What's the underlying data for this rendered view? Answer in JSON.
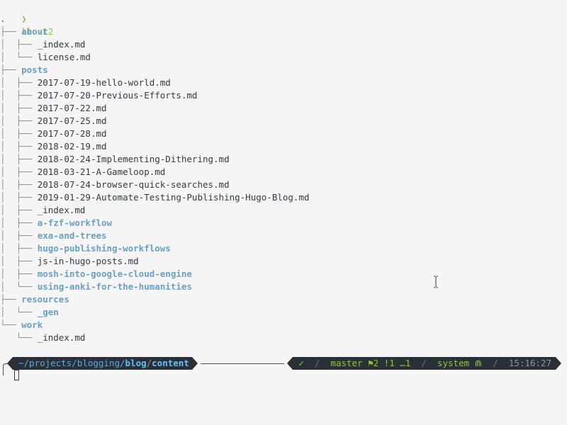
{
  "prompt": {
    "arrow": "❯",
    "command": "ll -L2"
  },
  "tree": {
    "root": ".",
    "rows": [
      {
        "prefix": "├── ",
        "name": "about",
        "kind": "dir"
      },
      {
        "prefix": "│  ├── ",
        "name": "_index.md",
        "kind": "file"
      },
      {
        "prefix": "│  └── ",
        "name": "license.md",
        "kind": "file"
      },
      {
        "prefix": "├── ",
        "name": "posts",
        "kind": "dir"
      },
      {
        "prefix": "│  ├── ",
        "name": "2017-07-19-hello-world.md",
        "kind": "file"
      },
      {
        "prefix": "│  ├── ",
        "name": "2017-07-20-Previous-Efforts.md",
        "kind": "file"
      },
      {
        "prefix": "│  ├── ",
        "name": "2017-07-22.md",
        "kind": "file"
      },
      {
        "prefix": "│  ├── ",
        "name": "2017-07-25.md",
        "kind": "file"
      },
      {
        "prefix": "│  ├── ",
        "name": "2017-07-28.md",
        "kind": "file"
      },
      {
        "prefix": "│  ├── ",
        "name": "2018-02-19.md",
        "kind": "file"
      },
      {
        "prefix": "│  ├── ",
        "name": "2018-02-24-Implementing-Dithering.md",
        "kind": "file"
      },
      {
        "prefix": "│  ├── ",
        "name": "2018-03-21-A-Gameloop.md",
        "kind": "file"
      },
      {
        "prefix": "│  ├── ",
        "name": "2018-07-24-browser-quick-searches.md",
        "kind": "file"
      },
      {
        "prefix": "│  ├── ",
        "name": "2019-01-29-Automate-Testing-Publishing-Hugo-Blog.md",
        "kind": "file"
      },
      {
        "prefix": "│  ├── ",
        "name": "_index.md",
        "kind": "file"
      },
      {
        "prefix": "│  ├── ",
        "name": "a-fzf-workflow",
        "kind": "dir"
      },
      {
        "prefix": "│  ├── ",
        "name": "exa-and-trees",
        "kind": "dir"
      },
      {
        "prefix": "│  ├── ",
        "name": "hugo-publishing-workflows",
        "kind": "dir"
      },
      {
        "prefix": "│  ├── ",
        "name": "js-in-hugo-posts.md",
        "kind": "file"
      },
      {
        "prefix": "│  ├── ",
        "name": "mosh-into-google-cloud-engine",
        "kind": "dir"
      },
      {
        "prefix": "│  └── ",
        "name": "using-anki-for-the-humanities",
        "kind": "dir"
      },
      {
        "prefix": "├── ",
        "name": "resources",
        "kind": "dir"
      },
      {
        "prefix": "│  └── ",
        "name": "_gen",
        "kind": "dir"
      },
      {
        "prefix": "└── ",
        "name": "work",
        "kind": "dir"
      },
      {
        "prefix": "   └── ",
        "name": "_index.md",
        "kind": "file"
      }
    ]
  },
  "statusbar": {
    "path_prefix": "~/projects/blogging/",
    "path_bold_1": "blog",
    "path_sep": "/",
    "path_bold_2": "content",
    "ok_mark": "✓",
    "branch": "master",
    "git_status": "⚑2 !1 …1",
    "env": "system",
    "env_icon": "⋒",
    "time": "15:16:27"
  },
  "colors": {
    "background": "#f5f5f5",
    "directory": "#6aa0c3",
    "accent_green": "#8fc73e",
    "bar_bg": "#2b2f36",
    "path_blue": "#4fb0e8"
  }
}
